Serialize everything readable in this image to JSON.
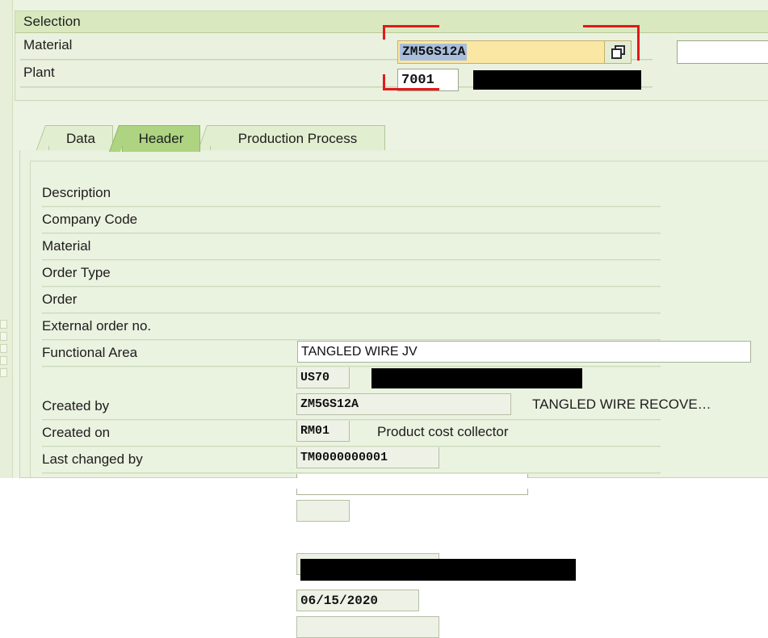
{
  "selection": {
    "title": "Selection",
    "rows": [
      {
        "label": "Material",
        "value": "ZM5GS12A",
        "button_icon": "multiple-selection-icon",
        "redacted": false
      },
      {
        "label": "Plant",
        "value": "7001",
        "redacted": true
      }
    ],
    "extra_field_value": ""
  },
  "tabs": [
    {
      "label": "Data",
      "active": false
    },
    {
      "label": "Header",
      "active": true
    },
    {
      "label": "Production Process",
      "active": false
    }
  ],
  "form": {
    "fields": [
      {
        "label": "Description",
        "value": "TANGLED WIRE JV",
        "trailing": ""
      },
      {
        "label": "Company Code",
        "value": "US70",
        "trailing": "",
        "trailing_redacted": true
      },
      {
        "label": "Material",
        "value": "ZM5GS12A",
        "trailing": "TANGLED WIRE RECOVE…"
      },
      {
        "label": "Order Type",
        "value": "RM01",
        "trailing": "Product cost collector"
      },
      {
        "label": "Order",
        "value": "TM0000000001",
        "trailing": ""
      },
      {
        "label": "External order no.",
        "value": "",
        "trailing": ""
      },
      {
        "label": "Functional Area",
        "value": "",
        "trailing": ""
      },
      {
        "label": "Created by",
        "value": "",
        "trailing": "",
        "trailing_redacted": true
      },
      {
        "label": "Created on",
        "value": "06/15/2020",
        "trailing": ""
      },
      {
        "label": "Last changed by",
        "value": "",
        "trailing": ""
      }
    ]
  },
  "colors": {
    "panel_bg": "#eaf2e0",
    "group_header": "#d9e8bf",
    "tab_active": "#aed482",
    "tab_inactive": "#e2eed0",
    "required_field": "#fbe7a4",
    "text_selection": "#a8bedd",
    "annotation": "#e4181b",
    "redaction": "#000000"
  }
}
